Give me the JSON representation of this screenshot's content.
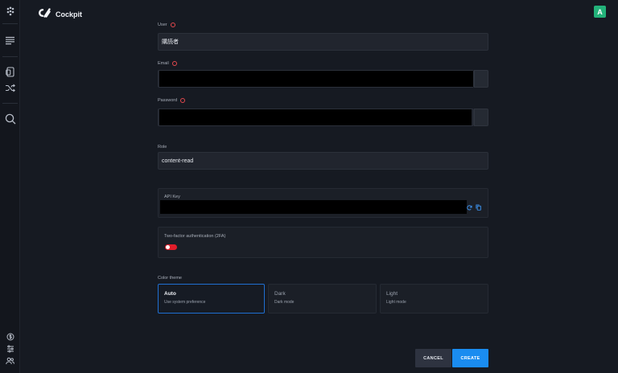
{
  "app": {
    "name": "Cockpit"
  },
  "user": {
    "avatar_letter": "A"
  },
  "form": {
    "user_label": "User",
    "user_value": "購読者",
    "email_label": "Email",
    "password_label": "Password",
    "role_label": "Role",
    "role_value": "content-read",
    "api_key_label": "API Key",
    "twofa_label": "Two-factor authentication (2FA)",
    "twofa_enabled": false,
    "color_theme_label": "Color theme",
    "themes": [
      {
        "name": "Auto",
        "desc": "Use system preference",
        "selected": true
      },
      {
        "name": "Dark",
        "desc": "Dark mode",
        "selected": false
      },
      {
        "name": "Light",
        "desc": "Light mode",
        "selected": false
      }
    ]
  },
  "actions": {
    "cancel": "CANCEL",
    "create": "CREATE"
  },
  "colors": {
    "accent": "#1a8cf0",
    "required": "#e5484d",
    "toggle": "#e11d2a",
    "avatar": "#23b27a"
  }
}
